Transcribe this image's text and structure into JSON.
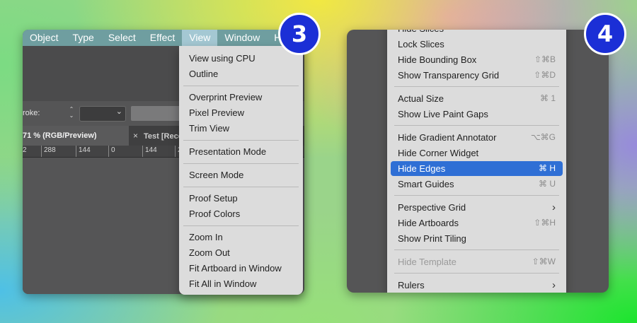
{
  "left_panel": {
    "badge": "3",
    "menubar": [
      {
        "label": "Object"
      },
      {
        "label": "Type"
      },
      {
        "label": "Select"
      },
      {
        "label": "Effect"
      },
      {
        "label": "View"
      },
      {
        "label": "Window"
      },
      {
        "label": "H"
      }
    ],
    "active_menu": "View",
    "toolbar": {
      "stroke_label": "roke:",
      "stepper_up": "^",
      "stepper_down": "v"
    },
    "doc_tabs": {
      "active": "71 % (RGB/Preview)",
      "inactive_close": "×",
      "inactive": "Test [Recovered"
    },
    "ruler": [
      "2",
      "288",
      "144",
      "0",
      "144",
      "2"
    ],
    "view_menu": {
      "items": [
        "View using CPU",
        "Outline",
        "Overprint Preview",
        "Pixel Preview",
        "Trim View",
        "Presentation Mode",
        "Screen Mode",
        "Proof Setup",
        "Proof Colors",
        "Zoom In",
        "Zoom Out",
        "Fit Artboard in Window",
        "Fit All in Window"
      ]
    }
  },
  "right_panel": {
    "badge": "4",
    "menu": {
      "items": [
        {
          "label": "Hide Slices",
          "shortcut": ""
        },
        {
          "label": "Lock Slices",
          "shortcut": ""
        },
        {
          "label": "Hide Bounding Box",
          "shortcut": "⇧⌘B"
        },
        {
          "label": "Show Transparency Grid",
          "shortcut": "⇧⌘D"
        },
        {
          "label": "Actual Size",
          "shortcut": "⌘ 1"
        },
        {
          "label": "Show Live Paint Gaps",
          "shortcut": ""
        },
        {
          "label": "Hide Gradient Annotator",
          "shortcut": "⌥⌘G"
        },
        {
          "label": "Hide Corner Widget",
          "shortcut": ""
        },
        {
          "label": "Hide Edges",
          "shortcut": "⌘ H"
        },
        {
          "label": "Smart Guides",
          "shortcut": "⌘ U"
        },
        {
          "label": "Perspective Grid",
          "shortcut": ""
        },
        {
          "label": "Hide Artboards",
          "shortcut": "⇧⌘H"
        },
        {
          "label": "Show Print Tiling",
          "shortcut": ""
        },
        {
          "label": "Hide Template",
          "shortcut": "⇧⌘W"
        },
        {
          "label": "Rulers",
          "shortcut": ""
        }
      ],
      "highlighted": "Hide Edges",
      "submenu_icon": "chevron-right-icon",
      "highlight_color": "#2f6fd5"
    }
  },
  "colors": {
    "badge": "#1b2fd6",
    "menubar": "#6f9ea0",
    "menubar_active": "#a4c8d3",
    "menu_bg": "#dcdcdc",
    "app_bg": "#555556"
  }
}
